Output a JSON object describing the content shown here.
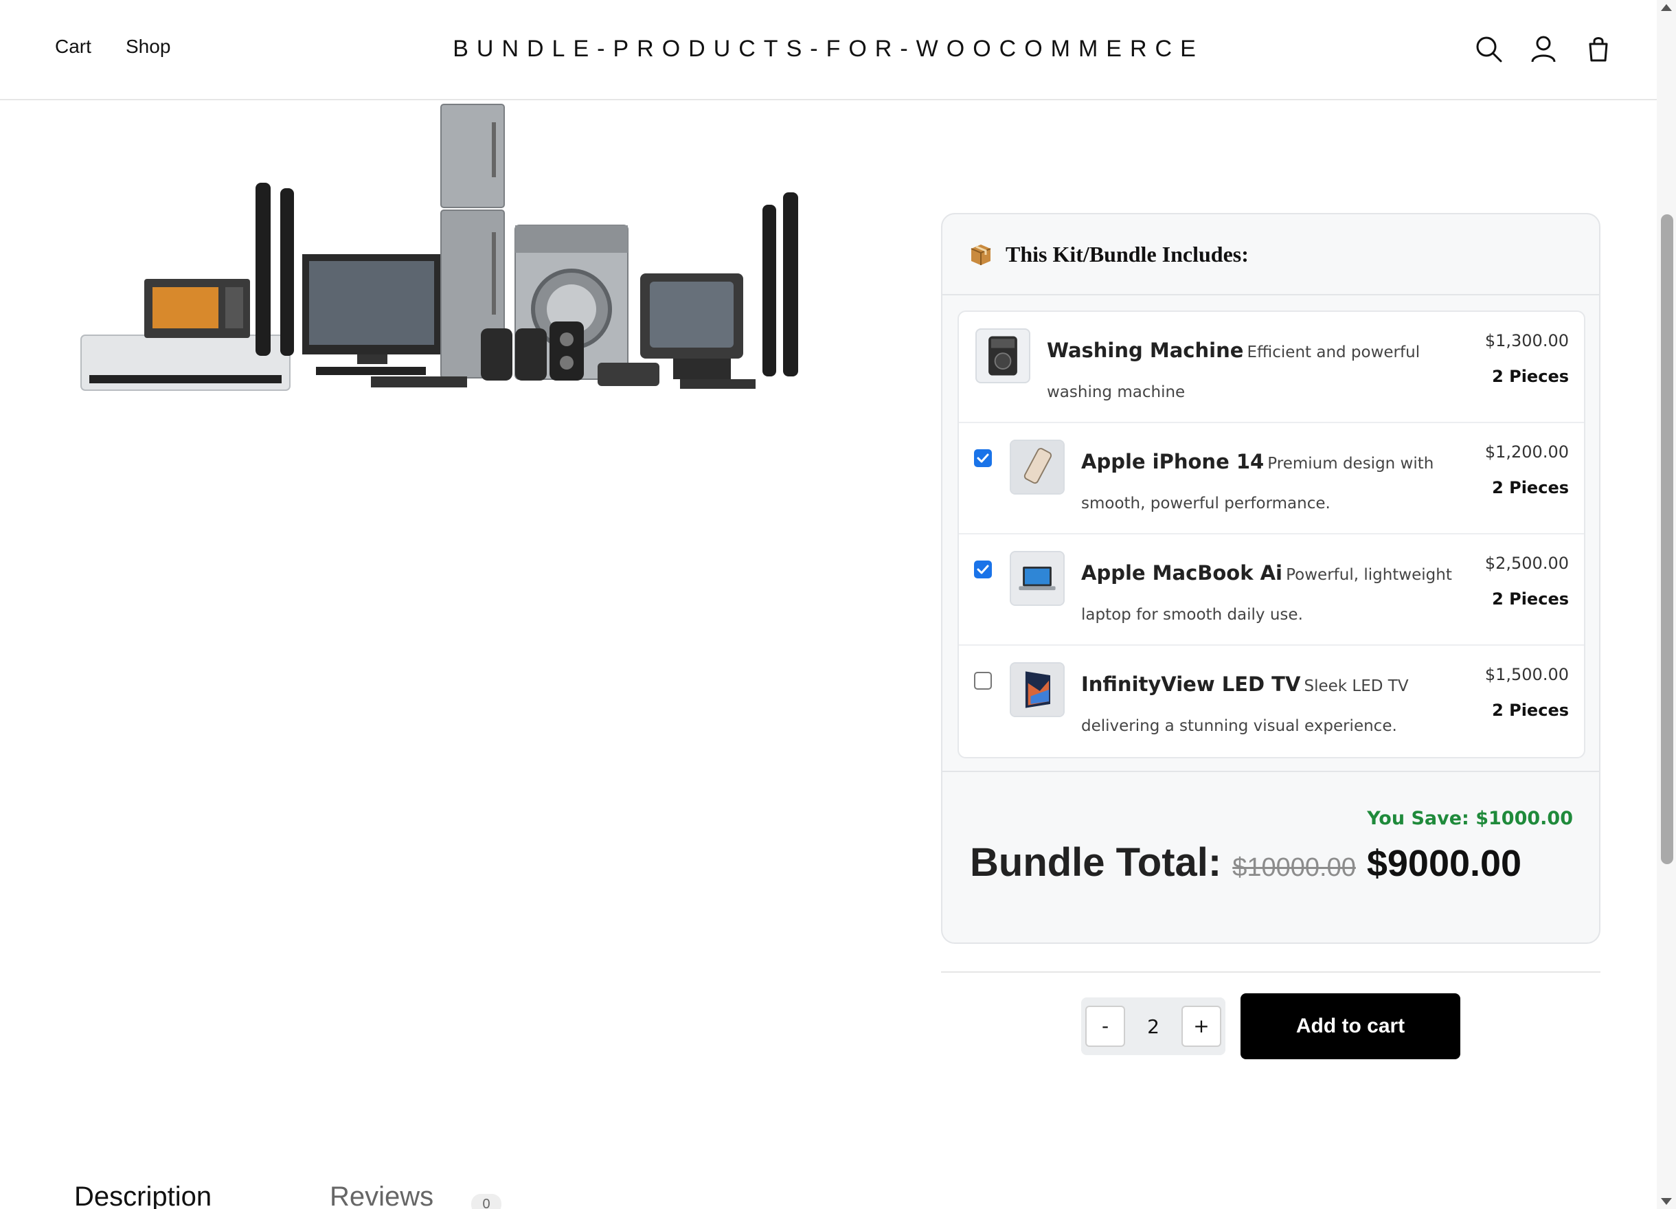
{
  "header": {
    "nav": [
      {
        "label": "Cart"
      },
      {
        "label": "Shop"
      }
    ],
    "site_title": "BUNDLE-PRODUCTS-FOR-WOOCOMMERCE",
    "icons": [
      "search-icon",
      "account-icon",
      "bag-icon"
    ]
  },
  "bundle": {
    "title": "This Kit/Bundle Includes:",
    "title_icon": "package-icon",
    "items": [
      {
        "name": "Washing Machine",
        "description": "Efficient and powerful washing machine",
        "price": "$1,300.00",
        "qty": "2 Pieces",
        "selectable": false,
        "checked": null,
        "thumb": "washing-machine"
      },
      {
        "name": "Apple iPhone 14",
        "description": "Premium design with smooth, powerful performance.",
        "price": "$1,200.00",
        "qty": "2 Pieces",
        "selectable": true,
        "checked": true,
        "thumb": "iphone"
      },
      {
        "name": "Apple MacBook Ai",
        "description": "Powerful, lightweight laptop for smooth daily use.",
        "price": "$2,500.00",
        "qty": "2 Pieces",
        "selectable": true,
        "checked": true,
        "thumb": "macbook"
      },
      {
        "name": "InfinityView LED TV",
        "description": "Sleek LED TV delivering a stunning visual experience.",
        "price": "$1,500.00",
        "qty": "2 Pieces",
        "selectable": true,
        "checked": false,
        "thumb": "led-tv"
      }
    ],
    "you_save": "You Save: $1000.00",
    "total_label": "Bundle Total:",
    "total_old": "$10000.00",
    "total_new": "$9000.00"
  },
  "cart": {
    "minus_label": "-",
    "qty_value": "2",
    "plus_label": "+",
    "add_label": "Add to cart"
  },
  "tabs": [
    {
      "label": "Description",
      "active": true
    },
    {
      "label": "Reviews",
      "badge": "0",
      "active": false
    }
  ],
  "colors": {
    "save_green": "#1f8a3b",
    "checkbox_blue": "#1a73e8",
    "button_black": "#000000"
  }
}
